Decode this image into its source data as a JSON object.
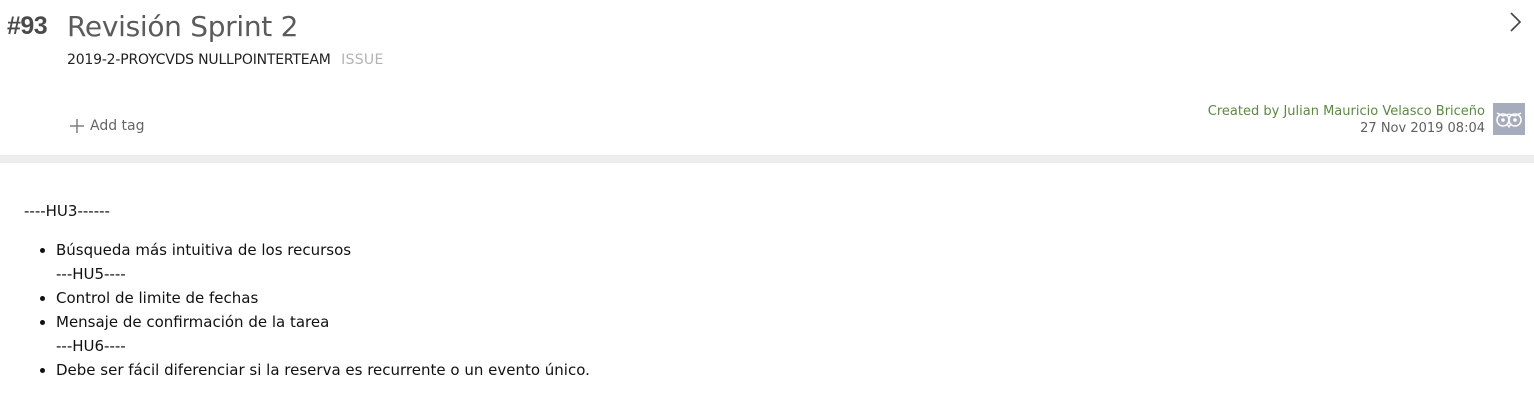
{
  "issue": {
    "ref": "#93",
    "title": "Revisión Sprint 2",
    "project": "2019-2-PROYCVDS NULLPOINTERTEAM",
    "type": "ISSUE"
  },
  "tags": {
    "add_label": "Add tag"
  },
  "meta": {
    "created_by": "Created by Julian Mauricio Velasco Briceño",
    "created_date": "27 Nov 2019 08:04"
  },
  "description": {
    "heading": "----HU3------",
    "items": [
      {
        "text": "Búsqueda más intuitiva de los recursos",
        "sub": "---HU5----"
      },
      {
        "text": "Control de limite de fechas"
      },
      {
        "text": "Mensaje de confirmación de la tarea",
        "sub": "---HU6----"
      },
      {
        "text": "Debe ser fácil diferenciar si la reserva es recurrente o un evento único."
      }
    ]
  },
  "colors": {
    "created_by": "#5a8a3f",
    "issue_type": "#b3b3b3",
    "divider": "#ededed",
    "avatar_bg": "#a7acbd"
  },
  "icons": {
    "next": "chevron-right-icon",
    "add": "plus-icon",
    "avatar": "owl-icon"
  }
}
